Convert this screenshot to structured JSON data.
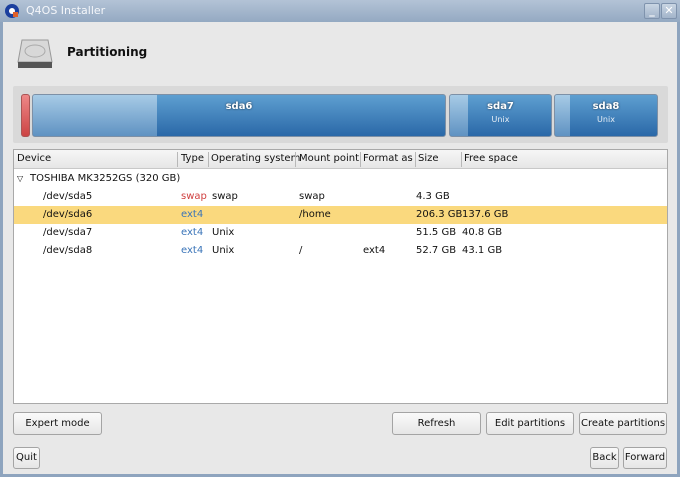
{
  "window": {
    "title": "Q4OS Installer",
    "minimize": "_",
    "close": "✕"
  },
  "header": {
    "title": "Partitioning",
    "icon": "hard-disk-icon"
  },
  "partitions_bar": [
    {
      "name": "sda6",
      "os": "",
      "used_fraction": 0.3
    },
    {
      "name": "sda7",
      "os": "Unix",
      "used_fraction": 0.18
    },
    {
      "name": "sda8",
      "os": "Unix",
      "used_fraction": 0.15
    }
  ],
  "table": {
    "columns": [
      "Device",
      "Type",
      "Operating system",
      "Mount point",
      "Format as",
      "Size",
      "Free space"
    ],
    "disk": "TOSHIBA MK3252GS (320 GB)",
    "rows": [
      {
        "device": "/dev/sda5",
        "type": "swap",
        "os": "swap",
        "mount": "swap",
        "format": "",
        "size": "4.3 GB",
        "free": ""
      },
      {
        "device": "/dev/sda6",
        "type": "ext4",
        "os": "",
        "mount": "/home",
        "format": "",
        "size": "206.3 GB",
        "free": "137.6 GB",
        "selected": true
      },
      {
        "device": "/dev/sda7",
        "type": "ext4",
        "os": "Unix",
        "mount": "",
        "format": "",
        "size": "51.5 GB",
        "free": "40.8 GB"
      },
      {
        "device": "/dev/sda8",
        "type": "ext4",
        "os": "Unix",
        "mount": "/",
        "format": "ext4",
        "size": "52.7 GB",
        "free": "43.1 GB"
      }
    ]
  },
  "buttons": {
    "expert": "Expert mode",
    "refresh": "Refresh",
    "edit": "Edit partitions",
    "create": "Create partitions",
    "quit": "Quit",
    "back": "Back",
    "forward": "Forward"
  },
  "colors": {
    "selection": "#fad97e",
    "swap": "#d04040",
    "ext4": "#3a74b8",
    "partition": "#2a68a8"
  }
}
